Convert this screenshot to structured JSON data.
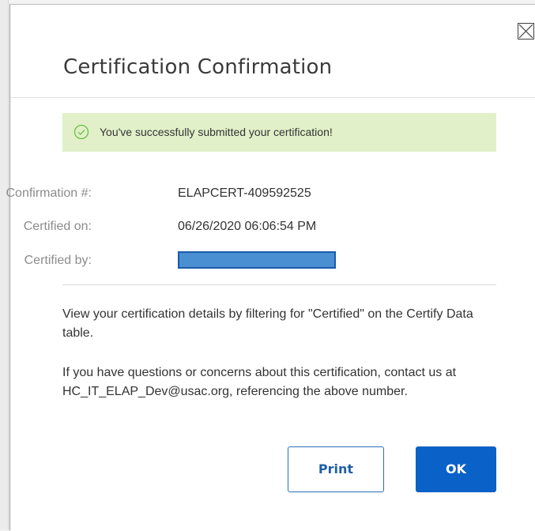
{
  "dialog": {
    "title": "Certification Confirmation",
    "close_icon": "close-icon"
  },
  "banner": {
    "icon": "check-circle-icon",
    "message": "You've successfully submitted your certification!",
    "background_color": "#e1f0c9",
    "icon_color": "#6cbf4a"
  },
  "details": {
    "confirmation_label": "Confirmation #:",
    "confirmation_value": "ELAPCERT-409592525",
    "certified_on_label": "Certified on:",
    "certified_on_value": "06/26/2020 06:06:54 PM",
    "certified_by_label": "Certified by:",
    "certified_by_redaction_color": "#4a8fd2"
  },
  "body": {
    "paragraph_1": "View your certification details by filtering for \"Certified\" on the Certify Data table.",
    "paragraph_2": "If you have questions or concerns about this certification, contact us at HC_IT_ELAP_Dev@usac.org, referencing the above number."
  },
  "actions": {
    "print_label": "Print",
    "ok_label": "OK",
    "primary_color": "#0a61c7"
  }
}
